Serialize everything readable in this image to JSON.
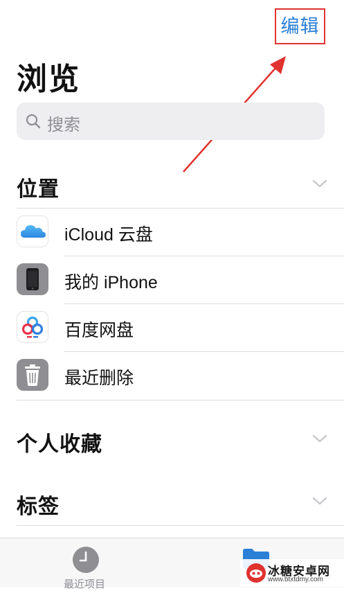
{
  "header": {
    "edit_label": "编辑",
    "title": "浏览"
  },
  "search": {
    "placeholder": "搜索"
  },
  "locations": {
    "title": "位置",
    "items": [
      {
        "label": "iCloud 云盘",
        "icon": "icloud-icon"
      },
      {
        "label": "我的 iPhone",
        "icon": "iphone-icon"
      },
      {
        "label": "百度网盘",
        "icon": "baidu-netdisk-icon"
      },
      {
        "label": "最近删除",
        "icon": "trash-icon"
      }
    ]
  },
  "favorites": {
    "title": "个人收藏"
  },
  "tags": {
    "title": "标签"
  },
  "tabbar": {
    "recent_label": "最近项目"
  },
  "watermark": {
    "name": "冰糖安卓网",
    "url": "www.btxtdmy.com"
  },
  "colors": {
    "accent": "#2a7fd6",
    "highlight": "#e0322f"
  }
}
